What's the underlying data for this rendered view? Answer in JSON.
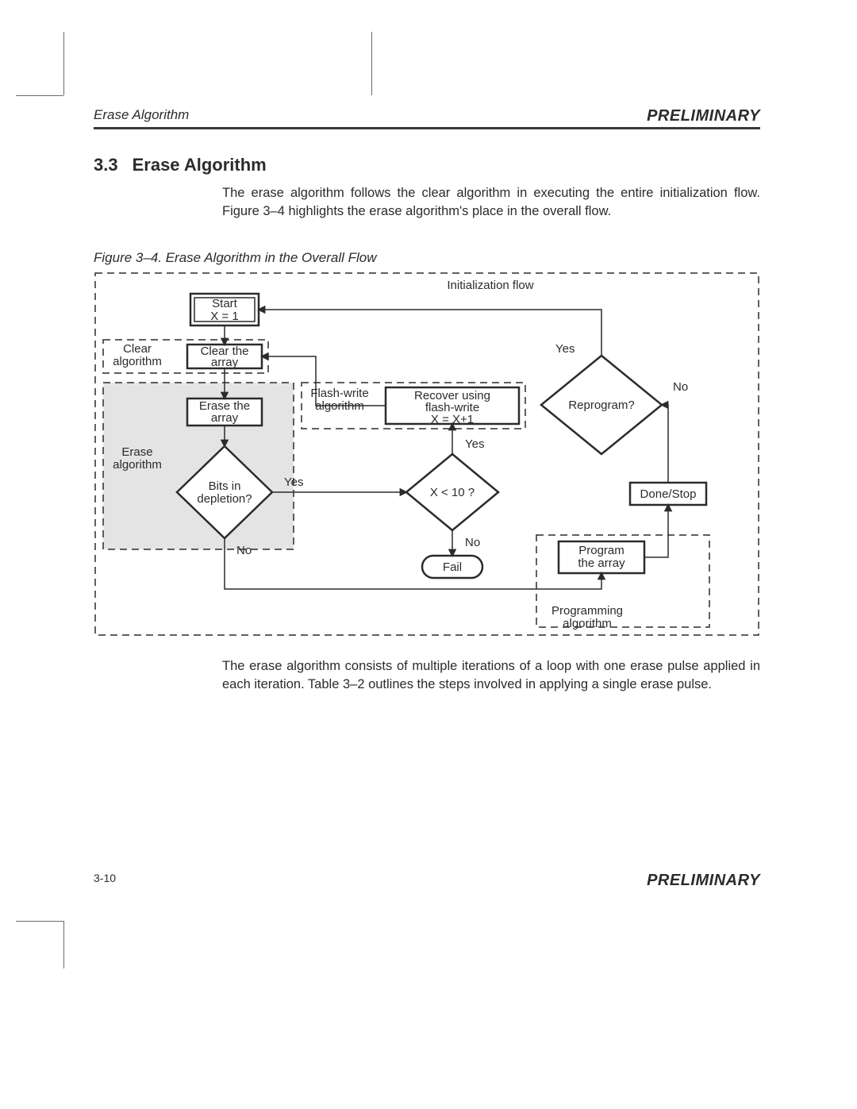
{
  "header": {
    "section": "Erase Algorithm",
    "status": "PRELIMINARY"
  },
  "heading": {
    "number": "3.3",
    "title": "Erase Algorithm"
  },
  "para1": "The erase algorithm follows the clear algorithm in executing the entire initialization flow. Figure 3–4 highlights the erase algorithm's place in the overall flow.",
  "figcap": "Figure 3–4.  Erase Algorithm in the Overall Flow",
  "diagram": {
    "frame_init": "Initialization flow",
    "start_l1": "Start",
    "start_l2": "X = 1",
    "clear_algo": "Clear\nalgorithm",
    "clear_array": "Clear the\narray",
    "erase_array": "Erase the\narray",
    "erase_algo": "Erase\nalgorithm",
    "bits_dep": "Bits in\ndepletion?",
    "flash_write_algo": "Flash-write\nalgorithm",
    "recover_l1": "Recover using",
    "recover_l2": "flash-write",
    "recover_l3": "X = X+1",
    "xlt10": "X < 10 ?",
    "fail": "Fail",
    "reprogram": "Reprogram?",
    "done_stop": "Done/Stop",
    "program_array": "Program\nthe array",
    "programming_algo": "Programming\nalgorithm",
    "yes": "Yes",
    "no": "No"
  },
  "para2": "The erase algorithm consists of multiple iterations of a loop with one erase pulse applied in each iteration. Table 3–2 outlines the steps involved in applying a single erase pulse.",
  "footer": {
    "page": "3-10",
    "status": "PRELIMINARY"
  }
}
